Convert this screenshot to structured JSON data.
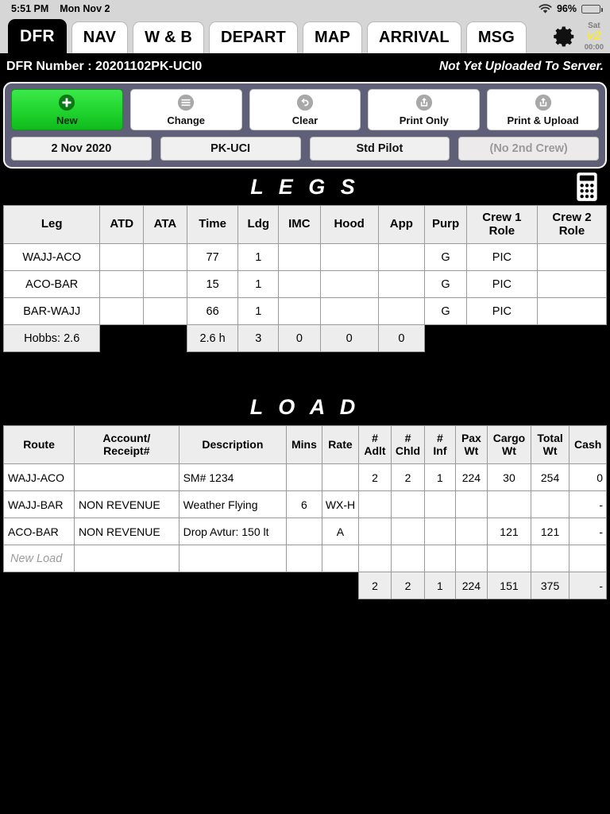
{
  "statusbar": {
    "time": "5:51 PM",
    "date": "Mon Nov 2",
    "wifi_icon": "wifi-icon",
    "battery_percent": "96%",
    "battery_icon": "battery-icon"
  },
  "tabs": [
    {
      "label": "DFR",
      "active": true
    },
    {
      "label": "NAV",
      "active": false
    },
    {
      "label": "W & B",
      "active": false
    },
    {
      "label": "DEPART",
      "active": false
    },
    {
      "label": "MAP",
      "active": false
    },
    {
      "label": "ARRIVAL",
      "active": false
    },
    {
      "label": "MSG",
      "active": false
    }
  ],
  "toolbar_right": {
    "gear_icon": "gear-icon",
    "sat_day": "Sat",
    "sat_version": "v2",
    "sat_time": "00:00"
  },
  "dfr_header": {
    "number_label": "DFR Number : 20201102PK-UCI0",
    "upload_status": "Not Yet Uploaded To Server."
  },
  "actions": [
    {
      "label": "New",
      "icon": "plus-circle-icon",
      "style": "green"
    },
    {
      "label": "Change",
      "icon": "list-circle-icon",
      "style": "white"
    },
    {
      "label": "Clear",
      "icon": "undo-circle-icon",
      "style": "white"
    },
    {
      "label": "Print Only",
      "icon": "share-circle-icon",
      "style": "white"
    },
    {
      "label": "Print & Upload",
      "icon": "share-circle-icon",
      "style": "white"
    }
  ],
  "fields": [
    {
      "label": "2 Nov 2020",
      "muted": false
    },
    {
      "label": "PK-UCI",
      "muted": false
    },
    {
      "label": "Std Pilot",
      "muted": false
    },
    {
      "label": "(No 2nd Crew)",
      "muted": true
    }
  ],
  "legs": {
    "title": "L E G S",
    "calculator_icon": "calculator-icon",
    "columns": [
      "Leg",
      "ATD",
      "ATA",
      "Time",
      "Ldg",
      "IMC",
      "Hood",
      "App",
      "Purp",
      "Crew 1\nRole",
      "Crew 2\nRole"
    ],
    "columns_flat": [
      "Leg",
      "ATD",
      "ATA",
      "Time",
      "Ldg",
      "IMC",
      "Hood",
      "App",
      "Purp",
      "Crew 1 Role",
      "Crew 2 Role"
    ],
    "rows": [
      {
        "leg": "WAJJ-ACO",
        "atd": "",
        "ata": "",
        "time": "77",
        "ldg": "1",
        "imc": "",
        "hood": "",
        "app": "",
        "purp": "G",
        "crew1": "PIC",
        "crew2": ""
      },
      {
        "leg": "ACO-BAR",
        "atd": "",
        "ata": "",
        "time": "15",
        "ldg": "1",
        "imc": "",
        "hood": "",
        "app": "",
        "purp": "G",
        "crew1": "PIC",
        "crew2": ""
      },
      {
        "leg": "BAR-WAJJ",
        "atd": "",
        "ata": "",
        "time": "66",
        "ldg": "1",
        "imc": "",
        "hood": "",
        "app": "",
        "purp": "G",
        "crew1": "PIC",
        "crew2": ""
      }
    ],
    "totals": {
      "hobbs": "Hobbs: 2.6",
      "time": "2.6 h",
      "ldg": "3",
      "imc": "0",
      "hood": "0",
      "app": "0"
    }
  },
  "load": {
    "title": "L O A D",
    "columns_flat": [
      "Route",
      "Account/Receipt#",
      "Description",
      "Mins",
      "Rate",
      "# Adlt",
      "# Chld",
      "# Inf",
      "Pax Wt",
      "Cargo Wt",
      "Total Wt",
      "Cash"
    ],
    "columns": [
      {
        "l1": "Route",
        "l2": ""
      },
      {
        "l1": "Account/",
        "l2": "Receipt#"
      },
      {
        "l1": "Description",
        "l2": ""
      },
      {
        "l1": "Mins",
        "l2": ""
      },
      {
        "l1": "Rate",
        "l2": ""
      },
      {
        "l1": "#",
        "l2": "Adlt"
      },
      {
        "l1": "#",
        "l2": "Chld"
      },
      {
        "l1": "#",
        "l2": "Inf"
      },
      {
        "l1": "Pax",
        "l2": "Wt"
      },
      {
        "l1": "Cargo",
        "l2": "Wt"
      },
      {
        "l1": "Total",
        "l2": "Wt"
      },
      {
        "l1": "Cash",
        "l2": ""
      }
    ],
    "rows": [
      {
        "route": "WAJJ-ACO",
        "account": "",
        "description": "SM# 1234",
        "mins": "",
        "rate": "",
        "adlt": "2",
        "chld": "2",
        "inf": "1",
        "paxwt": "224",
        "cargowt": "30",
        "totalwt": "254",
        "cash": "0"
      },
      {
        "route": "WAJJ-BAR",
        "account": "NON REVENUE",
        "description": "Weather Flying",
        "mins": "6",
        "rate": "WX-H",
        "adlt": "",
        "chld": "",
        "inf": "",
        "paxwt": "",
        "cargowt": "",
        "totalwt": "",
        "cash": "-"
      },
      {
        "route": "ACO-BAR",
        "account": "NON REVENUE",
        "description": "Drop Avtur: 150 lt",
        "mins": "",
        "rate": "A",
        "adlt": "",
        "chld": "",
        "inf": "",
        "paxwt": "",
        "cargowt": "121",
        "totalwt": "121",
        "cash": "-"
      },
      {
        "route": "New Load",
        "placeholder": true,
        "account": "",
        "description": "",
        "mins": "",
        "rate": "",
        "adlt": "",
        "chld": "",
        "inf": "",
        "paxwt": "",
        "cargowt": "",
        "totalwt": "",
        "cash": ""
      }
    ],
    "totals": {
      "adlt": "2",
      "chld": "2",
      "inf": "1",
      "paxwt": "224",
      "cargowt": "151",
      "totalwt": "375",
      "cash": "-"
    }
  },
  "colors": {
    "panel_bg": "#5f5f77",
    "new_button_green": "#22d62f",
    "sat_yellow": "#f5e93a",
    "status_bar_bg": "#d6d6d6"
  }
}
